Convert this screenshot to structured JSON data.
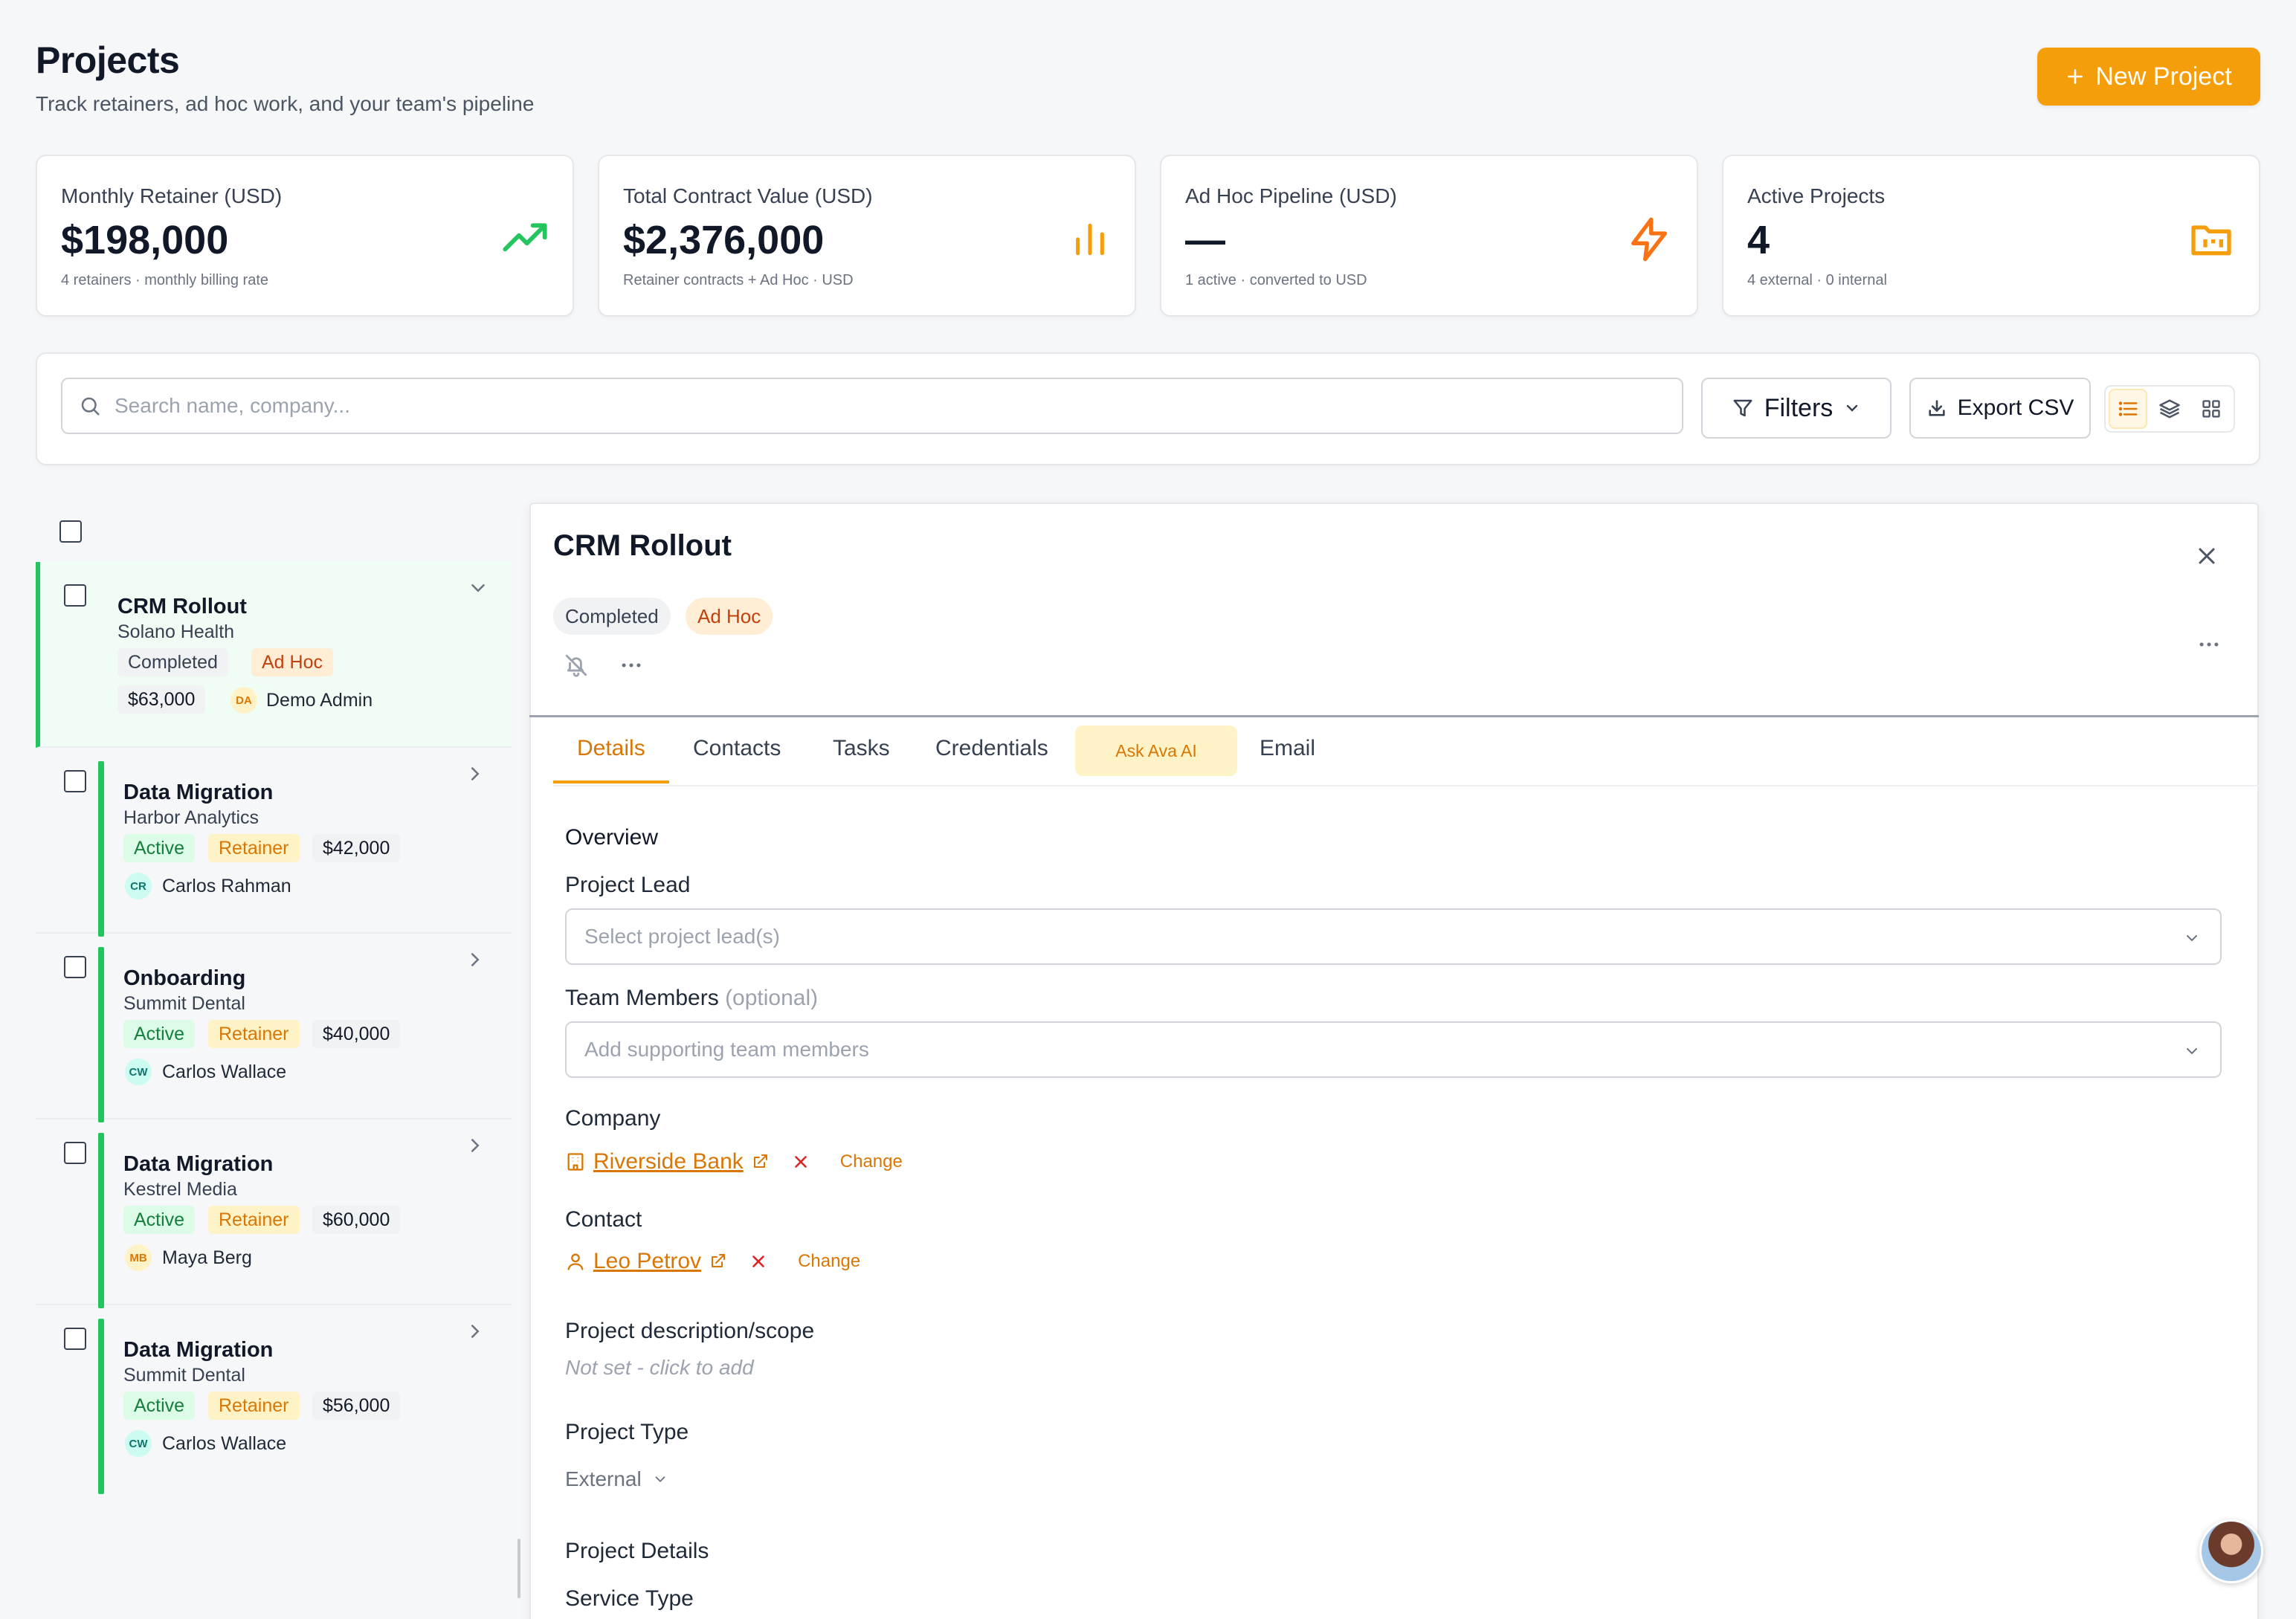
{
  "header": {
    "title": "Projects",
    "subtitle": "Track retainers, ad hoc work, and your team's pipeline",
    "new_project_label": "New Project"
  },
  "stats": [
    {
      "label": "Monthly Retainer (USD)",
      "value": "$198,000",
      "sub": "4 retainers · monthly billing rate",
      "icon": "trending-up-icon",
      "color": "#22c55e"
    },
    {
      "label": "Total Contract Value (USD)",
      "value": "$2,376,000",
      "sub": "Retainer contracts + Ad Hoc · USD",
      "icon": "bar-chart-icon",
      "color": "#f59e0b"
    },
    {
      "label": "Ad Hoc Pipeline (USD)",
      "value": "—",
      "sub": "1 active · converted to USD",
      "icon": "lightning-icon",
      "color": "#f97316"
    },
    {
      "label": "Active Projects",
      "value": "4",
      "sub": "4 external · 0 internal",
      "icon": "folder-icon",
      "color": "#f59e0b"
    }
  ],
  "toolbar": {
    "search_placeholder": "Search name, company...",
    "filters_label": "Filters",
    "export_label": "Export CSV"
  },
  "projects": [
    {
      "title": "CRM Rollout",
      "company": "Solano Health",
      "status": "Completed",
      "type": "Ad Hoc",
      "amount": "$63,000",
      "initials": "DA",
      "person": "Demo Admin"
    },
    {
      "title": "Data Migration",
      "company": "Harbor Analytics",
      "status": "Active",
      "type": "Retainer",
      "amount": "$42,000",
      "initials": "CR",
      "person": "Carlos Rahman"
    },
    {
      "title": "Onboarding",
      "company": "Summit Dental",
      "status": "Active",
      "type": "Retainer",
      "amount": "$40,000",
      "initials": "CW",
      "person": "Carlos Wallace"
    },
    {
      "title": "Data Migration",
      "company": "Kestrel Media",
      "status": "Active",
      "type": "Retainer",
      "amount": "$60,000",
      "initials": "MB",
      "person": "Maya Berg"
    },
    {
      "title": "Data Migration",
      "company": "Summit Dental",
      "status": "Active",
      "type": "Retainer",
      "amount": "$56,000",
      "initials": "CW",
      "person": "Carlos Wallace"
    }
  ],
  "detail": {
    "title": "CRM Rollout",
    "status": "Completed",
    "type": "Ad Hoc",
    "tabs": [
      "Details",
      "Contacts",
      "Tasks",
      "Credentials",
      "Ask Ava AI",
      "Email"
    ],
    "overview_label": "Overview",
    "project_lead_label": "Project Lead",
    "project_lead_placeholder": "Select project lead(s)",
    "team_members_label": "Team Members",
    "team_members_optional": "(optional)",
    "team_members_placeholder": "Add supporting team members",
    "company_label": "Company",
    "company_value": "Riverside Bank",
    "contact_label": "Contact",
    "contact_value": "Leo Petrov",
    "change_label": "Change",
    "description_label": "Project description/scope",
    "description_placeholder": "Not set - click to add",
    "project_type_label": "Project Type",
    "project_type_value": "External",
    "project_details_label": "Project Details",
    "service_type_label": "Service Type"
  }
}
